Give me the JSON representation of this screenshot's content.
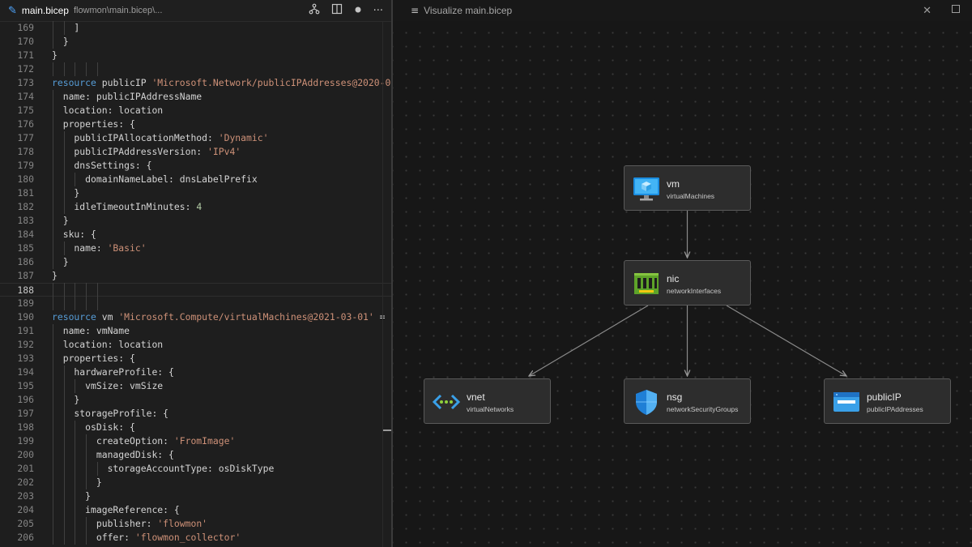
{
  "editor_tab": {
    "file_name": "main.bicep",
    "file_path": "flowmon\\main.bicep\\...",
    "icons": [
      "file-bicep-icon",
      "visualize-icon",
      "split-editor-icon",
      "unsaved-dot-icon",
      "more-actions-icon"
    ]
  },
  "visualizer_tab": {
    "title": "Visualize main.bicep",
    "icons": [
      "preview-icon",
      "close-icon",
      "restore-icon"
    ]
  },
  "code_lines": [
    {
      "num": "169",
      "text": "    ]"
    },
    {
      "num": "170",
      "text": "  }"
    },
    {
      "num": "171",
      "text": "}"
    },
    {
      "num": "172",
      "text": ""
    },
    {
      "num": "173",
      "text": "resource publicIP 'Microsoft.Network/publicIPAddresses@2020-0"
    },
    {
      "num": "174",
      "text": "  name: publicIPAddressName"
    },
    {
      "num": "175",
      "text": "  location: location"
    },
    {
      "num": "176",
      "text": "  properties: {"
    },
    {
      "num": "177",
      "text": "    publicIPAllocationMethod: 'Dynamic'"
    },
    {
      "num": "178",
      "text": "    publicIPAddressVersion: 'IPv4'"
    },
    {
      "num": "179",
      "text": "    dnsSettings: {"
    },
    {
      "num": "180",
      "text": "      domainNameLabel: dnsLabelPrefix"
    },
    {
      "num": "181",
      "text": "    }"
    },
    {
      "num": "182",
      "text": "    idleTimeoutInMinutes: 4"
    },
    {
      "num": "183",
      "text": "  }"
    },
    {
      "num": "184",
      "text": "  sku: {"
    },
    {
      "num": "185",
      "text": "    name: 'Basic'"
    },
    {
      "num": "186",
      "text": "  }"
    },
    {
      "num": "187",
      "text": "}"
    },
    {
      "num": "188",
      "text": ""
    },
    {
      "num": "189",
      "text": ""
    },
    {
      "num": "190",
      "text": "resource vm 'Microsoft.Compute/virtualMachines@2021-03-01' ="
    },
    {
      "num": "191",
      "text": "  name: vmName"
    },
    {
      "num": "192",
      "text": "  location: location"
    },
    {
      "num": "193",
      "text": "  properties: {"
    },
    {
      "num": "194",
      "text": "    hardwareProfile: {"
    },
    {
      "num": "195",
      "text": "      vmSize: vmSize"
    },
    {
      "num": "196",
      "text": "    }"
    },
    {
      "num": "197",
      "text": "    storageProfile: {"
    },
    {
      "num": "198",
      "text": "      osDisk: {"
    },
    {
      "num": "199",
      "text": "        createOption: 'FromImage'"
    },
    {
      "num": "200",
      "text": "        managedDisk: {"
    },
    {
      "num": "201",
      "text": "          storageAccountType: osDiskType"
    },
    {
      "num": "202",
      "text": "        }"
    },
    {
      "num": "203",
      "text": "      }"
    },
    {
      "num": "204",
      "text": "      imageReference: {"
    },
    {
      "num": "205",
      "text": "        publisher: 'flowmon'"
    },
    {
      "num": "206",
      "text": "        offer: 'flowmon_collector'"
    }
  ],
  "active_line": "188",
  "graph": {
    "nodes": [
      {
        "id": "vm",
        "name": "vm",
        "type": "virtualMachines",
        "icon": "virtual-machine-icon"
      },
      {
        "id": "nic",
        "name": "nic",
        "type": "networkInterfaces",
        "icon": "network-interface-icon"
      },
      {
        "id": "vnet",
        "name": "vnet",
        "type": "virtualNetworks",
        "icon": "virtual-network-icon"
      },
      {
        "id": "nsg",
        "name": "nsg",
        "type": "networkSecurityGroups",
        "icon": "network-security-group-icon"
      },
      {
        "id": "publicIP",
        "name": "publicIP",
        "type": "publicIPAddresses",
        "icon": "public-ip-icon"
      }
    ],
    "edges": [
      {
        "from": "vm",
        "to": "nic"
      },
      {
        "from": "nic",
        "to": "vnet"
      },
      {
        "from": "nic",
        "to": "nsg"
      },
      {
        "from": "nic",
        "to": "publicIP"
      }
    ]
  },
  "colors": {
    "keyword": "#569cd6",
    "string": "#ce9178",
    "number": "#b5cea8",
    "text": "#d4d4d4",
    "tab_accent": "#4fa6ff"
  }
}
